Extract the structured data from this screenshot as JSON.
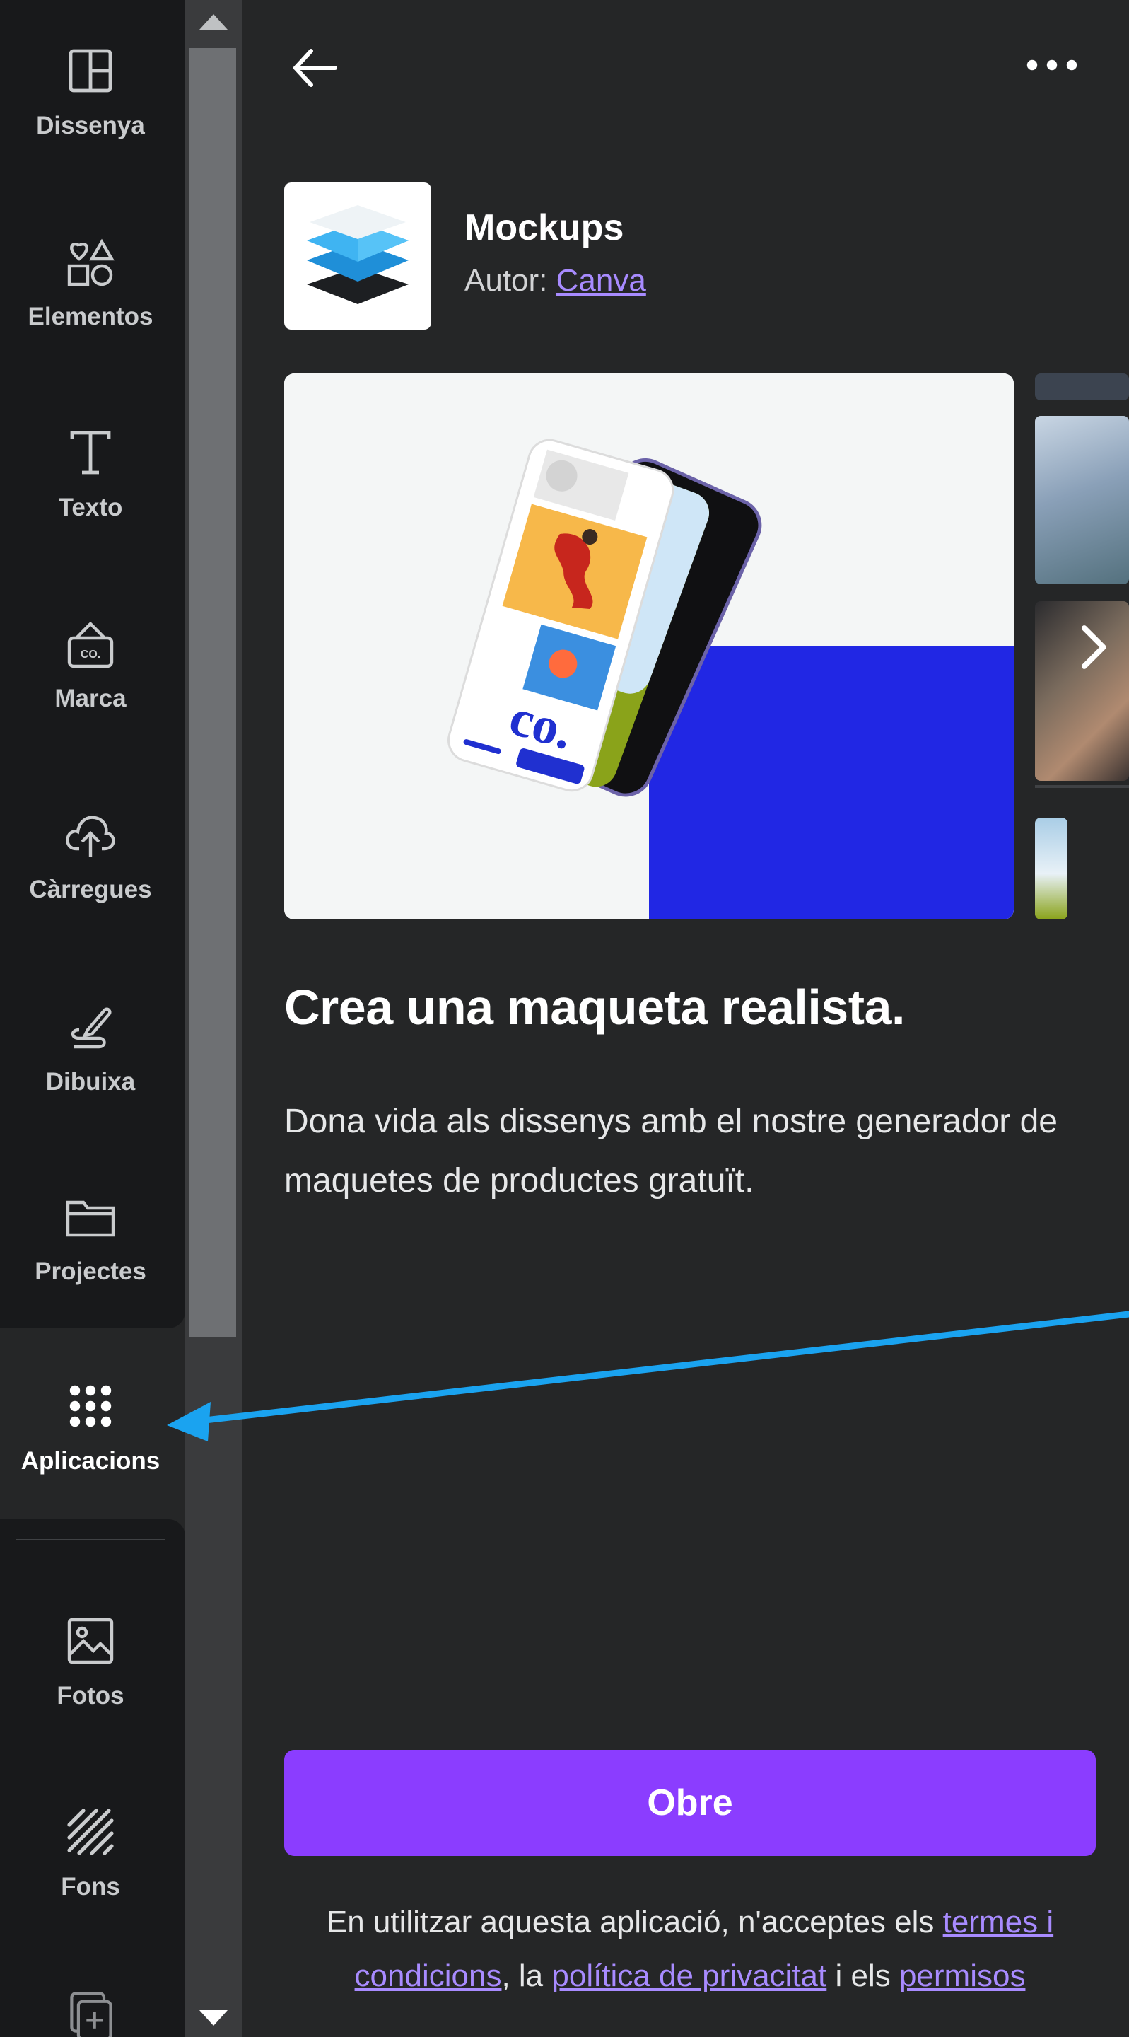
{
  "sidebar": {
    "items": [
      {
        "label": "Dissenya",
        "icon": "layout-icon"
      },
      {
        "label": "Elementos",
        "icon": "shapes-icon"
      },
      {
        "label": "Texto",
        "icon": "text-icon"
      },
      {
        "label": "Marca",
        "icon": "brand-kit-icon"
      },
      {
        "label": "Càrregues",
        "icon": "cloud-upload-icon"
      },
      {
        "label": "Dibuixa",
        "icon": "pen-icon"
      },
      {
        "label": "Projectes",
        "icon": "folder-icon"
      },
      {
        "label": "Aplicacions",
        "icon": "apps-grid-icon",
        "active": true
      },
      {
        "label": "Fotos",
        "icon": "image-icon"
      },
      {
        "label": "Fons",
        "icon": "pattern-icon"
      }
    ]
  },
  "header": {
    "back_icon": "arrow-left-icon",
    "more_icon": "more-horizontal-icon"
  },
  "app": {
    "name": "Mockups",
    "author_prefix": "Autor: ",
    "author_link": "Canva",
    "logo_icon": "stacked-layers-logo",
    "hero_brand_text": "co."
  },
  "content": {
    "headline": "Crea una maqueta realista.",
    "description": "Dona vida als dissenys amb el nostre generador de maquetes de productes gratuït."
  },
  "cta": {
    "open_label": "Obre"
  },
  "terms": {
    "prefix": "En utilitzar aquesta aplicació, n'acceptes els ",
    "terms_link": "termes i condicions",
    "mid1": ", la ",
    "privacy_link": "política de privacitat",
    "mid2": " i els ",
    "permissions_link": "permisos"
  },
  "colors": {
    "accent": "#8b3dff",
    "link": "#a88bff",
    "annotation_arrow": "#1aa3f0",
    "panel_bg": "#252627",
    "rail_bg": "#18191b"
  }
}
